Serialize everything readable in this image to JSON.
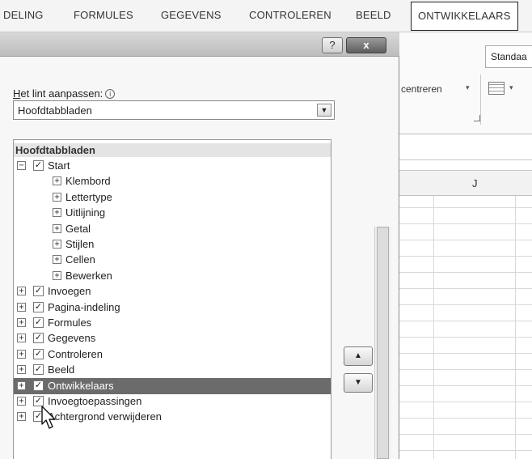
{
  "ribbon": {
    "tabs": [
      {
        "label": "DELING"
      },
      {
        "label": "FORMULES"
      },
      {
        "label": "GEGEVENS"
      },
      {
        "label": "CONTROLEREN"
      },
      {
        "label": "BEELD"
      },
      {
        "label": "ONTWIKKELAARS",
        "active": true
      }
    ],
    "style_combo": "Standaa",
    "center_label": "centreren",
    "dropdown_glyph": "▾"
  },
  "sheet": {
    "column_headers": [
      "J"
    ]
  },
  "dialog": {
    "help_glyph": "?",
    "close_glyph": "x",
    "customize_label_accel": "H",
    "customize_label_rest": "et lint aanpassen:",
    "info_glyph": "i",
    "select_value": "Hoofdtabbladen",
    "select_arrow": "▼",
    "tree": {
      "header": "Hoofdtabbladen",
      "rows": [
        {
          "label": "Start",
          "level": 0,
          "expander": "−",
          "checked": true
        },
        {
          "label": "Klembord",
          "level": 1,
          "expander": "+"
        },
        {
          "label": "Lettertype",
          "level": 1,
          "expander": "+"
        },
        {
          "label": "Uitlijning",
          "level": 1,
          "expander": "+"
        },
        {
          "label": "Getal",
          "level": 1,
          "expander": "+"
        },
        {
          "label": "Stijlen",
          "level": 1,
          "expander": "+"
        },
        {
          "label": "Cellen",
          "level": 1,
          "expander": "+"
        },
        {
          "label": "Bewerken",
          "level": 1,
          "expander": "+"
        },
        {
          "label": "Invoegen",
          "level": 0,
          "expander": "+",
          "checked": true
        },
        {
          "label": "Pagina-indeling",
          "level": 0,
          "expander": "+",
          "checked": true
        },
        {
          "label": "Formules",
          "level": 0,
          "expander": "+",
          "checked": true
        },
        {
          "label": "Gegevens",
          "level": 0,
          "expander": "+",
          "checked": true
        },
        {
          "label": "Controleren",
          "level": 0,
          "expander": "+",
          "checked": true
        },
        {
          "label": "Beeld",
          "level": 0,
          "expander": "+",
          "checked": true
        },
        {
          "label": "Ontwikkelaars",
          "level": 0,
          "expander": "+",
          "checked": true,
          "selected": true
        },
        {
          "label": "Invoegtoepassingen",
          "level": 0,
          "expander": "+",
          "checked": true
        },
        {
          "label": "Achtergrond verwijderen",
          "level": 0,
          "expander": "+",
          "checked": true
        }
      ]
    },
    "move_up_glyph": "▲",
    "move_down_glyph": "▼",
    "check_glyph": "✓"
  }
}
